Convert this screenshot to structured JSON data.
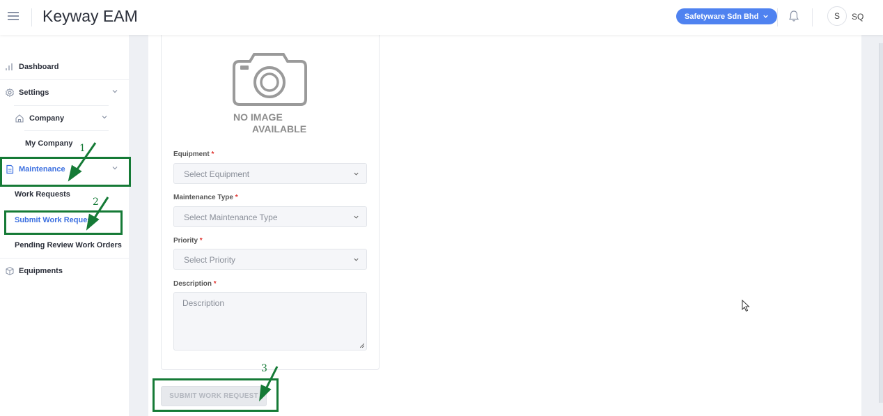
{
  "header": {
    "brand": "Keyway EAM",
    "company_selector": "Safetyware Sdn Bhd",
    "avatar_initial": "S",
    "user_name": "SQ"
  },
  "sidebar": {
    "items": [
      {
        "label": "Dashboard",
        "icon": "bar-chart-icon"
      },
      {
        "label": "Settings",
        "icon": "gear-icon"
      },
      {
        "label": "Company",
        "icon": "home-icon"
      },
      {
        "label": "My Company"
      },
      {
        "label": "Maintenance",
        "icon": "document-icon"
      },
      {
        "label": "Work Requests"
      },
      {
        "label": "Submit Work Request"
      },
      {
        "label": "Pending Review Work Orders"
      },
      {
        "label": "Equipments",
        "icon": "cube-icon"
      }
    ]
  },
  "form": {
    "no_image_line1": "NO IMAGE",
    "no_image_line2": "AVAILABLE",
    "equipment_label": "Equipment",
    "equipment_placeholder": "Select Equipment",
    "maintenance_type_label": "Maintenance Type",
    "maintenance_type_placeholder": "Select Maintenance Type",
    "priority_label": "Priority",
    "priority_placeholder": "Select Priority",
    "description_label": "Description",
    "description_placeholder": "Description",
    "required_mark": "*",
    "submit_label": "SUBMIT WORK REQUEST"
  },
  "annotations": {
    "step1": "1",
    "step2": "2",
    "step3": "3",
    "color": "#157a36"
  },
  "colors": {
    "accent": "#4f82f0",
    "active_link": "#3b6fe0",
    "required": "#e0332e"
  }
}
